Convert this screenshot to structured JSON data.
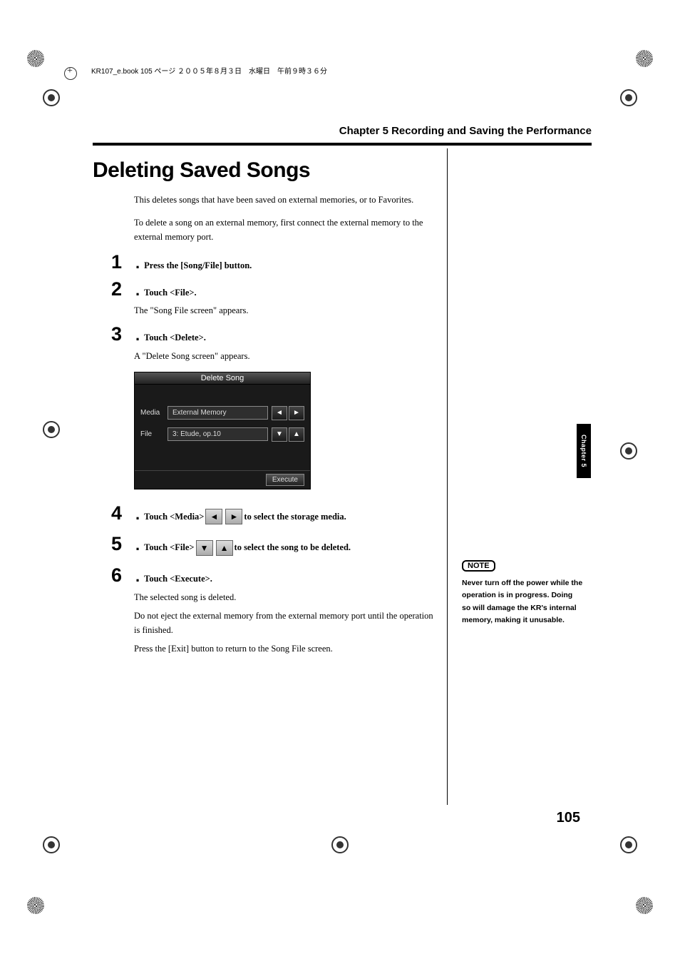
{
  "header_info": "KR107_e.book  105 ページ  ２００５年８月３日　水曜日　午前９時３６分",
  "chapter_header": "Chapter 5 Recording and Saving the Performance",
  "section_title": "Deleting Saved Songs",
  "intro_p1": "This deletes songs that have been saved on external memories, or to Favorites.",
  "intro_p2": "To delete a song on an external  memory, first connect the external memory to the external memory port.",
  "steps": {
    "s1": {
      "num": "1",
      "text": "Press the [Song/File] button."
    },
    "s2": {
      "num": "2",
      "text": "Touch <File>.",
      "desc": "The \"Song File screen\" appears."
    },
    "s3": {
      "num": "3",
      "text": "Touch <Delete>.",
      "desc": "A \"Delete Song screen\" appears."
    },
    "s4": {
      "num": "4",
      "text_a": "Touch <Media>",
      "text_b": "to select the storage media."
    },
    "s5": {
      "num": "5",
      "text_a": "Touch <File>",
      "text_b": "to select the song to be deleted."
    },
    "s6": {
      "num": "6",
      "text": "Touch <Execute>.",
      "desc1": "The selected song is deleted.",
      "desc2": "Do not eject the external memory from the external memory port until the operation is finished.",
      "desc3": "Press the [Exit] button to return to the Song File screen."
    }
  },
  "screen": {
    "title": "Delete Song",
    "media_label": "Media",
    "media_value": "External Memory",
    "file_label": "File",
    "file_value": "3: Etude, op.10",
    "execute": "Execute"
  },
  "arrows": {
    "left": "◄",
    "right": "►",
    "down": "▼",
    "up": "▲"
  },
  "side_tab": "Chapter 5",
  "note": {
    "label": "NOTE",
    "text": "Never turn off the power while the operation is in progress. Doing so will damage the KR's internal memory, making it unusable."
  },
  "page_number": "105"
}
